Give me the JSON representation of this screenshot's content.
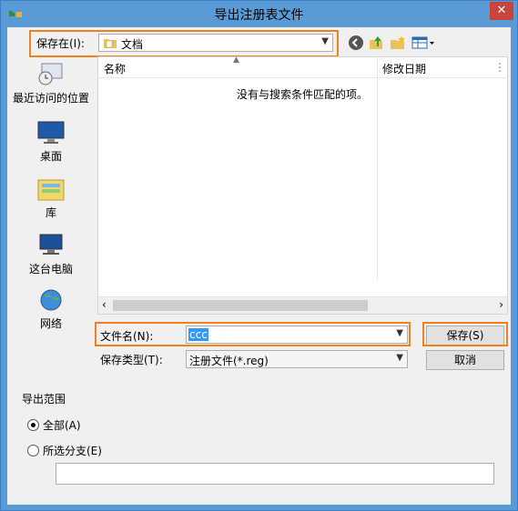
{
  "window": {
    "title": "导出注册表文件",
    "close": "✕"
  },
  "save_in": {
    "label": "保存在(I):",
    "value": "文档"
  },
  "toolbar": {
    "back": "back-icon",
    "up": "up-folder-icon",
    "new_folder": "new-folder-icon",
    "view": "view-menu-icon"
  },
  "places": [
    {
      "label": "最近访问的位置",
      "icon": "recent-places-icon"
    },
    {
      "label": "桌面",
      "icon": "desktop-icon"
    },
    {
      "label": "库",
      "icon": "libraries-icon"
    },
    {
      "label": "这台电脑",
      "icon": "this-pc-icon"
    },
    {
      "label": "网络",
      "icon": "network-icon"
    }
  ],
  "file_list": {
    "columns": [
      "名称",
      "修改日期"
    ],
    "empty_message": "没有与搜索条件匹配的项。"
  },
  "filename": {
    "label": "文件名(N):",
    "value": "ccc"
  },
  "filetype": {
    "label": "保存类型(T):",
    "value": "注册文件(*.reg)"
  },
  "buttons": {
    "save": "保存(S)",
    "cancel": "取消"
  },
  "export_range": {
    "title": "导出范围",
    "options": [
      {
        "label": "全部(A)",
        "selected": true
      },
      {
        "label": "所选分支(E)",
        "selected": false
      }
    ],
    "branch_value": ""
  },
  "colors": {
    "highlight": "#f0821e",
    "selection": "#3399ff"
  }
}
